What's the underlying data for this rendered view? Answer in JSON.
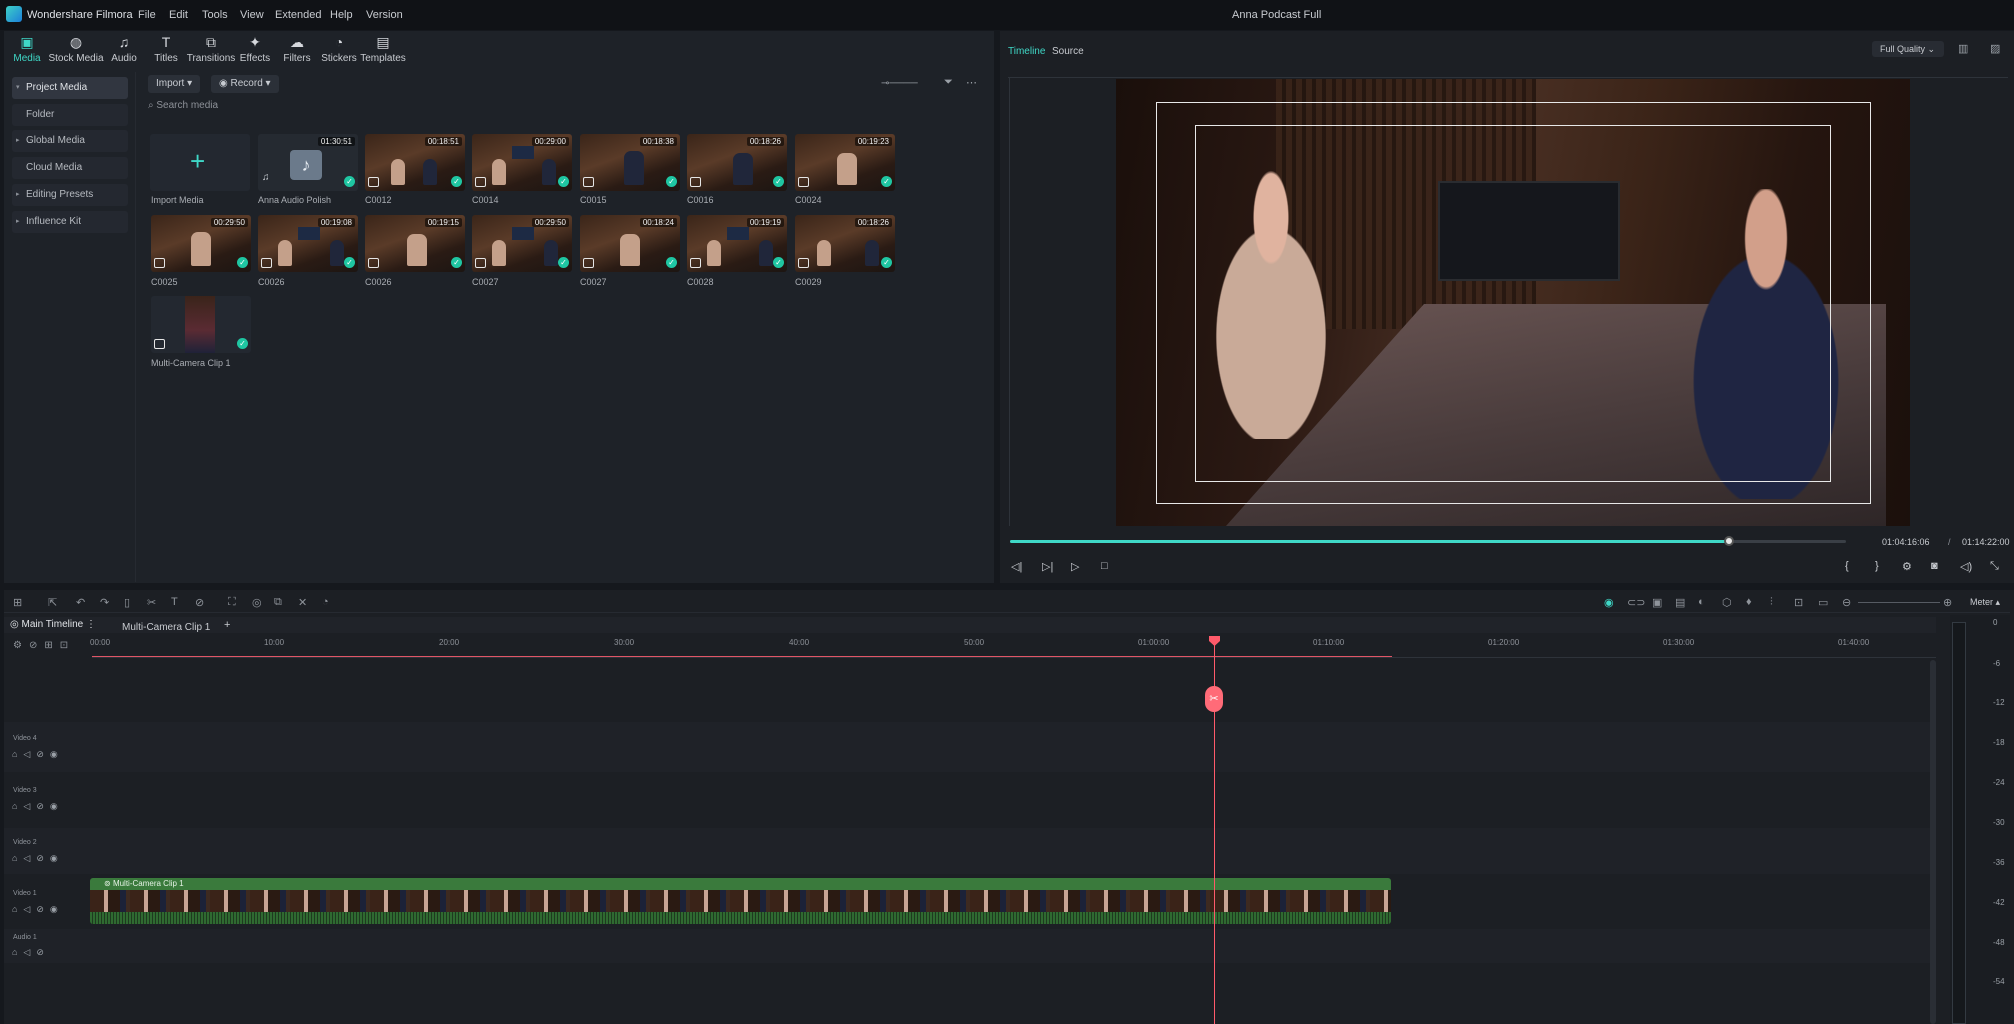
{
  "app": {
    "name": "Wondershare Filmora",
    "document_title": "Anna Podcast Full",
    "menu": [
      "File",
      "Edit",
      "Tools",
      "View",
      "Extended",
      "Help",
      "Version"
    ]
  },
  "toolbar": [
    "Media",
    "Stock Media",
    "Audio",
    "Titles",
    "Transitions",
    "Effects",
    "Filters",
    "Stickers",
    "Templates"
  ],
  "sidebar": [
    "Project Media",
    "Folder",
    "Global Media",
    "Cloud Media",
    "Editing Presets",
    "Influence Kit"
  ],
  "media": {
    "import_label": "Import",
    "record_label": "Record",
    "search_placeholder": "Search media",
    "import_media_label": "Import Media",
    "audio": {
      "label": "Anna Audio Polish",
      "duration": "01:30:51"
    },
    "clips": [
      {
        "label": "C0012",
        "duration": "00:18:51"
      },
      {
        "label": "C0014",
        "duration": "00:29:00"
      },
      {
        "label": "C0015",
        "duration": "00:18:38"
      },
      {
        "label": "C0016",
        "duration": "00:18:26"
      },
      {
        "label": "C0024",
        "duration": "00:19:23"
      },
      {
        "label": "C0025",
        "duration": "00:29:50"
      },
      {
        "label": "C0026",
        "duration": "00:19:08"
      },
      {
        "label": "C0026",
        "duration": "00:19:15"
      },
      {
        "label": "C0027",
        "duration": "00:29:50"
      },
      {
        "label": "C0027",
        "duration": "00:18:24"
      },
      {
        "label": "C0028",
        "duration": "00:19:19"
      },
      {
        "label": "C0029",
        "duration": "00:18:26"
      }
    ],
    "multicam": {
      "label": "Multi-Camera Clip 1"
    }
  },
  "preview": {
    "tab_timeline": "Timeline",
    "tab_source": "Source",
    "quality": "Full Quality",
    "current_time": "01:04:16:06",
    "separator": "/",
    "total_time": "01:14:22:00",
    "progress": 0.86
  },
  "timeline": {
    "tab_main": "Main Timeline",
    "tab_multi": "Multi-Camera Clip 1",
    "ticks": [
      "00:00",
      "10:00",
      "20:00",
      "30:00",
      "40:00",
      "50:00",
      "01:00:00",
      "01:10:00",
      "01:20:00",
      "01:30:00",
      "01:40:00"
    ],
    "tracks": [
      "Video 4",
      "Video 3",
      "Video 2",
      "Video 1",
      "Audio 1"
    ],
    "clip_label": "Multi-Camera Clip 1",
    "meter_label": "Meter",
    "meter_db": [
      "0",
      "-6",
      "-12",
      "-18",
      "-24",
      "-30",
      "-36",
      "-42",
      "-48",
      "-54"
    ]
  }
}
